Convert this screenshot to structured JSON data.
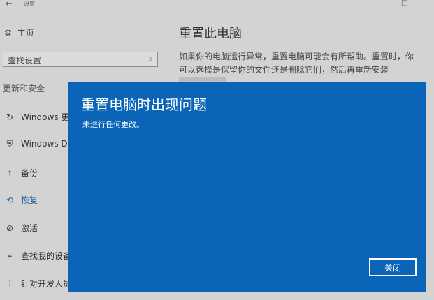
{
  "window": {
    "back_glyph": "←",
    "title": "设置",
    "minimize_glyph": "—",
    "maximize_glyph": "□"
  },
  "sidebar": {
    "home_icon": "⚙",
    "home_label": "主页",
    "search_placeholder": "查找设置",
    "search_icon": "⌕",
    "section_title": "更新和安全",
    "items": [
      {
        "icon": "↻",
        "label": "Windows 更新"
      },
      {
        "icon": "⛨",
        "label": "Windows Defender"
      },
      {
        "icon": "⤒",
        "label": "备份"
      },
      {
        "icon": "⟲",
        "label": "恢复"
      },
      {
        "icon": "⊘",
        "label": "激活"
      },
      {
        "icon": "⌖",
        "label": "查找我的设备"
      },
      {
        "icon": "⫶",
        "label": "针对开发人员"
      }
    ]
  },
  "main": {
    "title": "重置此电脑",
    "description": "如果你的电脑运行异常，重置电脑可能会有所帮助。重置时，你可以选择是保留你的文件还是删除它们，然后再重新安装 Windows。"
  },
  "dialog": {
    "title": "重置电脑时出现问题",
    "message": "未进行任何更改。",
    "close_label": "关闭"
  },
  "colors": {
    "dialog_bg": "#0a64b7",
    "overlay_bg": "#d3d3d3",
    "selected_nav": "#1f5aa0"
  }
}
